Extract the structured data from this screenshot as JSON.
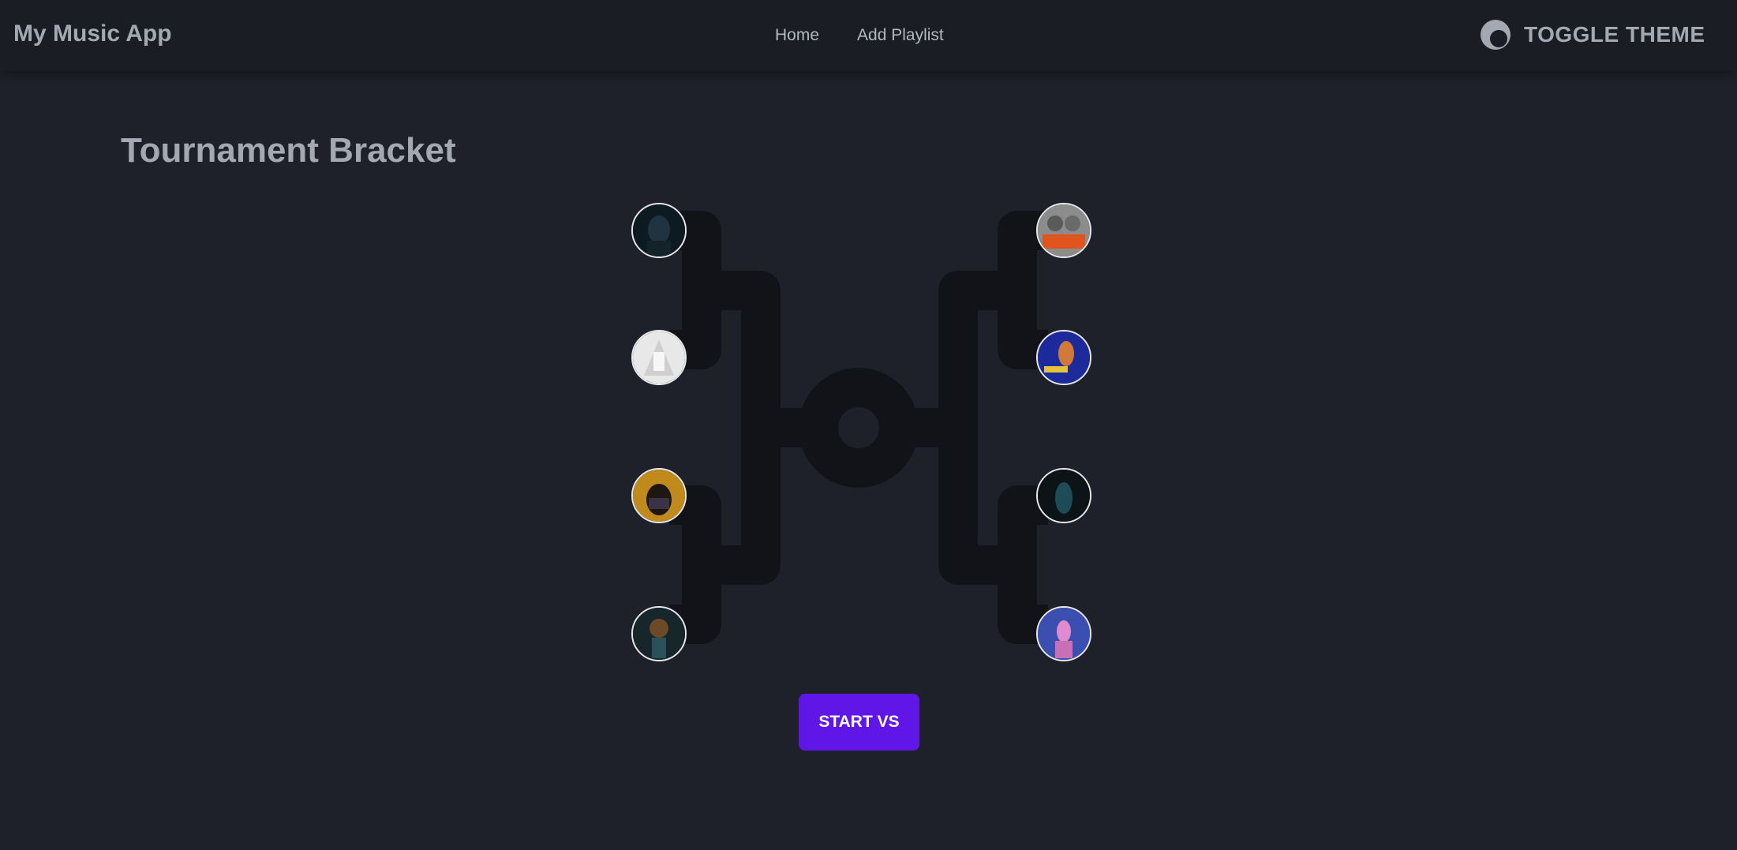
{
  "app": {
    "title": "My Music App"
  },
  "nav": {
    "links": [
      {
        "label": "Home"
      },
      {
        "label": "Add Playlist"
      }
    ],
    "toggle_theme_label": "TOGGLE THEME",
    "toggle_theme_icon": "moon-icon"
  },
  "page": {
    "title": "Tournament Bracket"
  },
  "bracket": {
    "line_color": "#111318",
    "left_side": [
      {
        "name": "album-cover-1",
        "colors": [
          "#0e1a22",
          "#1f3340"
        ]
      },
      {
        "name": "album-cover-2",
        "colors": [
          "#d8d8d8",
          "#f4f4f4"
        ]
      },
      {
        "name": "album-cover-3",
        "colors": [
          "#c08a1c",
          "#2a1d0e"
        ]
      },
      {
        "name": "album-cover-4",
        "colors": [
          "#16262b",
          "#5b3a1c"
        ]
      }
    ],
    "right_side": [
      {
        "name": "album-cover-5",
        "colors": [
          "#8c8c8c",
          "#e0541e"
        ]
      },
      {
        "name": "album-cover-6",
        "colors": [
          "#1c2a9c",
          "#d07a3a"
        ]
      },
      {
        "name": "album-cover-7",
        "colors": [
          "#0c1417",
          "#1d4c58"
        ]
      },
      {
        "name": "album-cover-8",
        "colors": [
          "#3a4fb0",
          "#e08bd0"
        ]
      }
    ]
  },
  "actions": {
    "start_label": "START VS",
    "start_color": "#5f16e6"
  }
}
